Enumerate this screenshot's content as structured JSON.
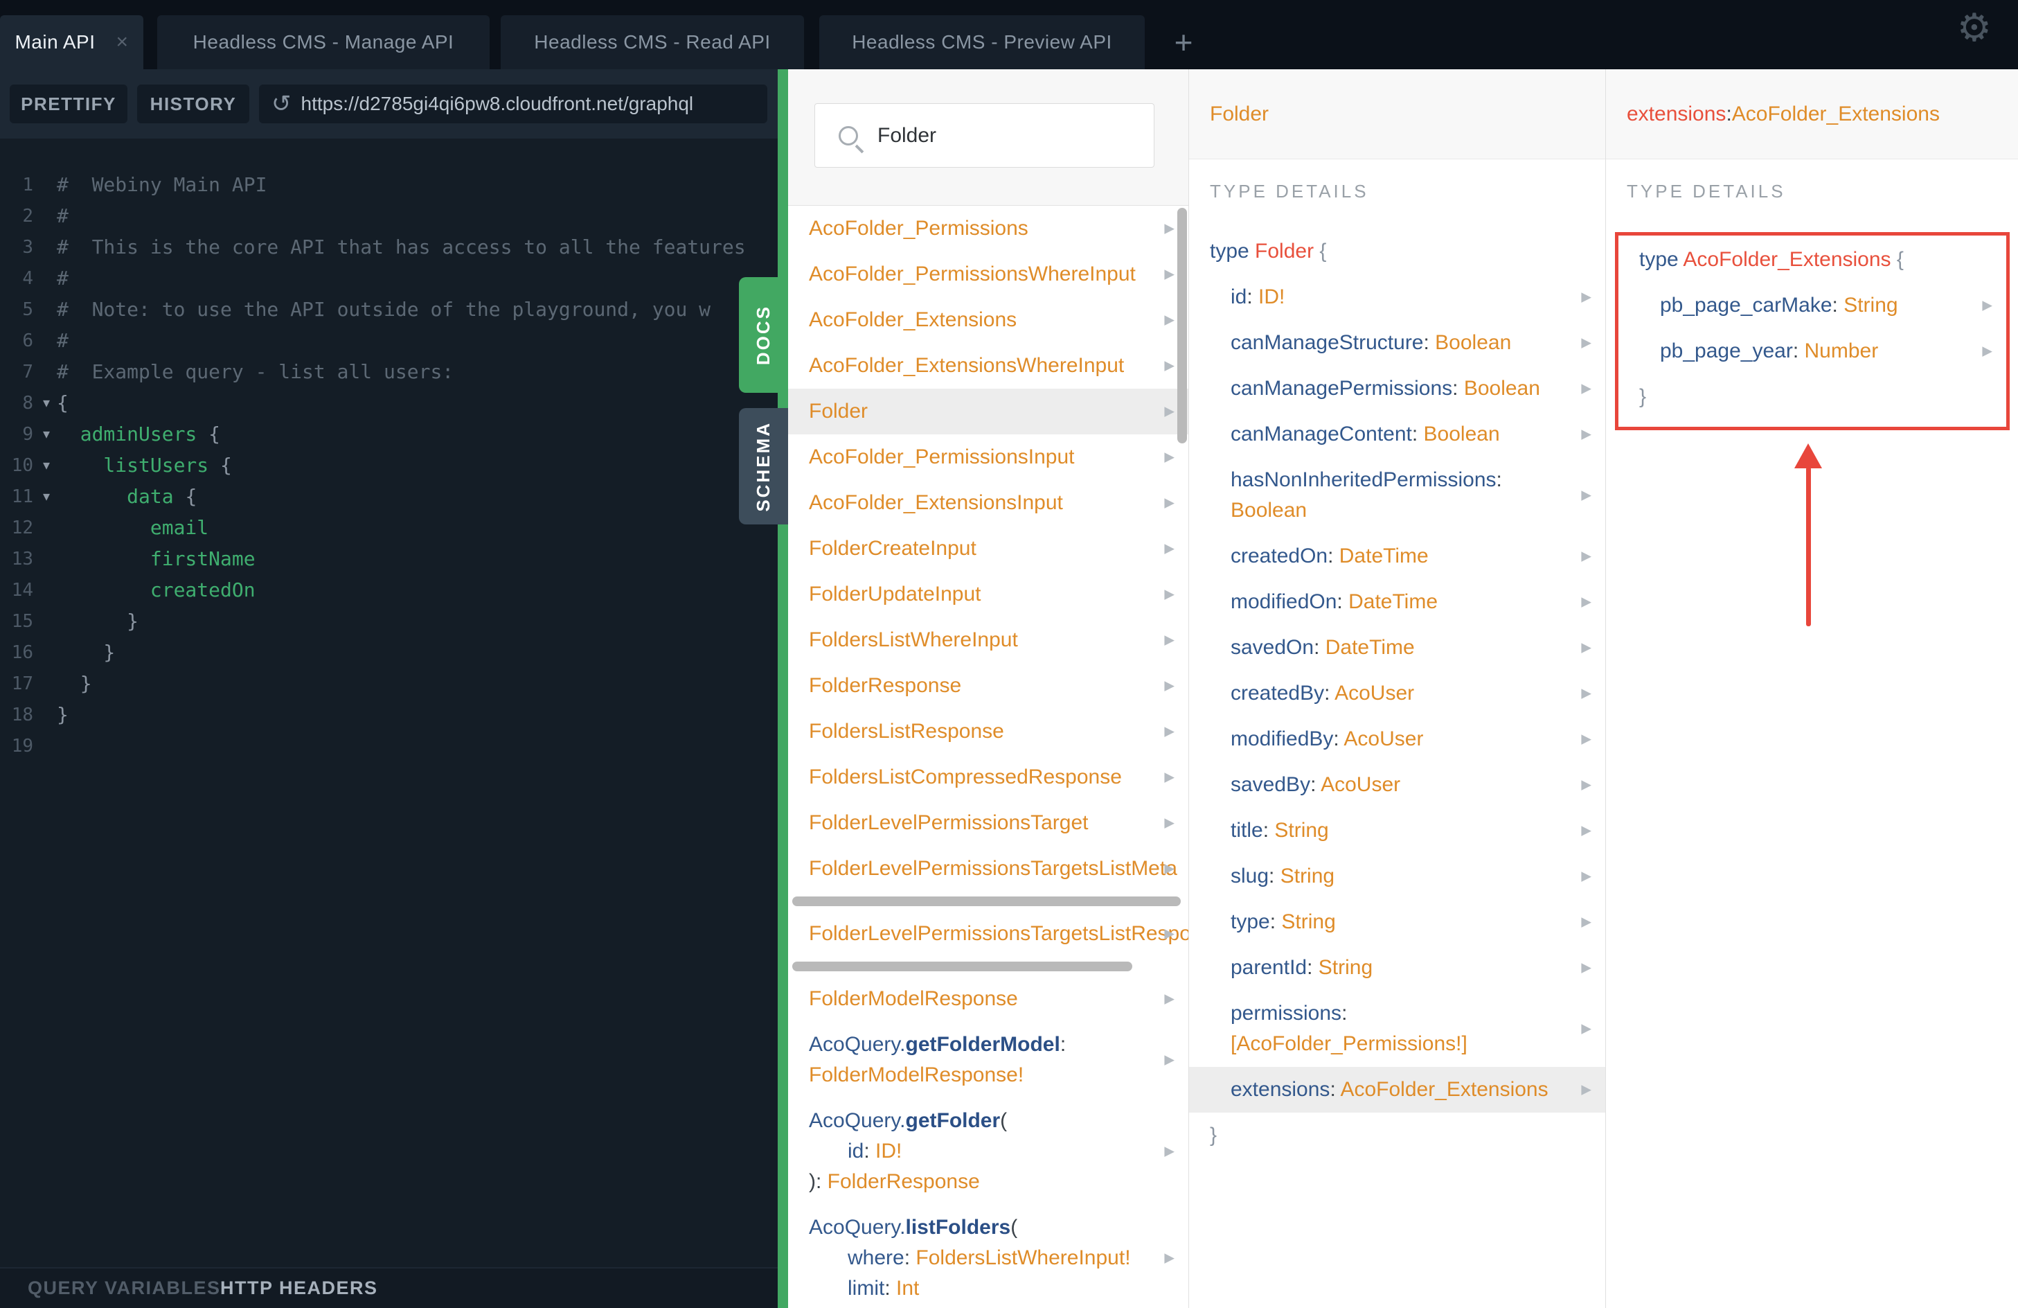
{
  "topbar": {
    "tabs": [
      {
        "label": "Main API",
        "active": true
      },
      {
        "label": "Headless CMS - Manage API",
        "active": false
      },
      {
        "label": "Headless CMS - Read API",
        "active": false
      },
      {
        "label": "Headless CMS - Preview API",
        "active": false
      }
    ],
    "close_label": "×",
    "add_label": "+",
    "gear_icon": "⚙"
  },
  "toolbar": {
    "prettify_label": "PRETTIFY",
    "history_label": "HISTORY",
    "reload_icon": "↺",
    "url": "https://d2785gi4qi6pw8.cloudfront.net/graphql"
  },
  "side_tabs": {
    "docs": "DOCS",
    "schema": "SCHEMA"
  },
  "editor": {
    "lines": [
      {
        "n": "1",
        "fold": false,
        "segments": [
          [
            "comment",
            "#  Webiny Main API"
          ]
        ]
      },
      {
        "n": "2",
        "fold": false,
        "segments": [
          [
            "comment",
            "#"
          ]
        ]
      },
      {
        "n": "3",
        "fold": false,
        "segments": [
          [
            "comment",
            "#  This is the core API that has access to all the features"
          ]
        ]
      },
      {
        "n": "4",
        "fold": false,
        "segments": [
          [
            "comment",
            "#"
          ]
        ]
      },
      {
        "n": "5",
        "fold": false,
        "segments": [
          [
            "comment",
            "#  Note: to use the API outside of the playground, you w"
          ]
        ]
      },
      {
        "n": "6",
        "fold": false,
        "segments": [
          [
            "comment",
            "#"
          ]
        ]
      },
      {
        "n": "7",
        "fold": false,
        "segments": [
          [
            "comment",
            "#  Example query - list all users:"
          ]
        ]
      },
      {
        "n": "8",
        "fold": true,
        "segments": [
          [
            "brace",
            "{"
          ]
        ]
      },
      {
        "n": "9",
        "fold": true,
        "segments": [
          [
            "green",
            "  adminUsers "
          ],
          [
            "brace",
            "{"
          ]
        ]
      },
      {
        "n": "10",
        "fold": true,
        "segments": [
          [
            "green",
            "    listUsers "
          ],
          [
            "brace",
            "{"
          ]
        ]
      },
      {
        "n": "11",
        "fold": true,
        "segments": [
          [
            "green",
            "      data "
          ],
          [
            "brace",
            "{"
          ]
        ]
      },
      {
        "n": "12",
        "fold": false,
        "segments": [
          [
            "green",
            "        email"
          ]
        ]
      },
      {
        "n": "13",
        "fold": false,
        "segments": [
          [
            "green",
            "        firstName"
          ]
        ]
      },
      {
        "n": "14",
        "fold": false,
        "segments": [
          [
            "green",
            "        createdOn"
          ]
        ]
      },
      {
        "n": "15",
        "fold": false,
        "segments": [
          [
            "brace",
            "      }"
          ]
        ]
      },
      {
        "n": "16",
        "fold": false,
        "segments": [
          [
            "brace",
            "    }"
          ]
        ]
      },
      {
        "n": "17",
        "fold": false,
        "segments": [
          [
            "brace",
            "  }"
          ]
        ]
      },
      {
        "n": "18",
        "fold": false,
        "segments": [
          [
            "brace",
            "}"
          ]
        ]
      },
      {
        "n": "19",
        "fold": false,
        "segments": []
      }
    ]
  },
  "docs": {
    "search_value": "Folder",
    "items": [
      {
        "kind": "simple",
        "text": "AcoFolder_Permissions",
        "arrow": true
      },
      {
        "kind": "simple",
        "text": "AcoFolder_PermissionsWhereInput",
        "arrow": true
      },
      {
        "kind": "simple",
        "text": "AcoFolder_Extensions",
        "arrow": true
      },
      {
        "kind": "simple",
        "text": "AcoFolder_ExtensionsWhereInput",
        "arrow": true
      },
      {
        "kind": "simple",
        "text": "Folder",
        "arrow": true,
        "highlight": true
      },
      {
        "kind": "simple",
        "text": "AcoFolder_PermissionsInput",
        "arrow": true
      },
      {
        "kind": "simple",
        "text": "AcoFolder_ExtensionsInput",
        "arrow": true
      },
      {
        "kind": "simple",
        "text": "FolderCreateInput",
        "arrow": true
      },
      {
        "kind": "simple",
        "text": "FolderUpdateInput",
        "arrow": true
      },
      {
        "kind": "simple",
        "text": "FoldersListWhereInput",
        "arrow": true
      },
      {
        "kind": "simple",
        "text": "FolderResponse",
        "arrow": true
      },
      {
        "kind": "simple",
        "text": "FoldersListResponse",
        "arrow": true
      },
      {
        "kind": "simple",
        "text": "FoldersListCompressedResponse",
        "arrow": true
      },
      {
        "kind": "simple",
        "text": "FolderLevelPermissionsTarget",
        "arrow": true
      },
      {
        "kind": "simple",
        "text": "FolderLevelPermissionsTargetsListMeta",
        "arrow": true,
        "clip": true
      },
      {
        "kind": "hscroll",
        "width_pct": 97
      },
      {
        "kind": "simple",
        "text": "FolderLevelPermissionsTargetsListResponse",
        "arrow": true,
        "clip": true
      },
      {
        "kind": "hscroll",
        "width_pct": 85
      },
      {
        "kind": "simple",
        "text": "FolderModelResponse",
        "arrow": true
      },
      {
        "kind": "block",
        "arrow": true,
        "lines": [
          {
            "indent": 0,
            "seg": [
              [
                "blue",
                "AcoQuery."
              ],
              [
                "blueb",
                "getFolderModel"
              ],
              [
                "dark",
                ":"
              ]
            ]
          },
          {
            "indent": 0,
            "seg": [
              [
                "orange",
                "FolderModelResponse!"
              ]
            ]
          }
        ]
      },
      {
        "kind": "block",
        "arrow": true,
        "lines": [
          {
            "indent": 0,
            "seg": [
              [
                "blue",
                "AcoQuery."
              ],
              [
                "blueb",
                "getFolder"
              ],
              [
                "dark",
                "("
              ]
            ]
          },
          {
            "indent": 1,
            "seg": [
              [
                "blue",
                "id"
              ],
              [
                "dark",
                ": "
              ],
              [
                "orange",
                "ID!"
              ]
            ]
          },
          {
            "indent": 0,
            "seg": [
              [
                "dark",
                "): "
              ],
              [
                "orange",
                "FolderResponse"
              ]
            ]
          }
        ]
      },
      {
        "kind": "block",
        "arrow": true,
        "lines": [
          {
            "indent": 0,
            "seg": [
              [
                "blue",
                "AcoQuery."
              ],
              [
                "blueb",
                "listFolders"
              ],
              [
                "dark",
                "("
              ]
            ]
          },
          {
            "indent": 1,
            "seg": [
              [
                "blue",
                "where"
              ],
              [
                "dark",
                ": "
              ],
              [
                "orange",
                "FoldersListWhereInput!"
              ]
            ]
          },
          {
            "indent": 1,
            "seg": [
              [
                "blue",
                "limit"
              ],
              [
                "dark",
                ": "
              ],
              [
                "orange",
                "Int"
              ]
            ]
          }
        ]
      }
    ]
  },
  "folder_pane": {
    "title": "Folder",
    "section_label": "TYPE DETAILS",
    "rows": [
      {
        "arrow": false,
        "lines": [
          {
            "indent": 0,
            "seg": [
              [
                "blue",
                "type "
              ],
              [
                "red",
                "Folder "
              ],
              [
                "gray",
                "{"
              ]
            ]
          }
        ]
      },
      {
        "arrow": true,
        "lines": [
          {
            "indent": 1,
            "seg": [
              [
                "blue",
                "id"
              ],
              [
                "dark",
                ": "
              ],
              [
                "orange",
                "ID!"
              ]
            ]
          }
        ]
      },
      {
        "arrow": true,
        "lines": [
          {
            "indent": 1,
            "seg": [
              [
                "blue",
                "canManageStructure"
              ],
              [
                "dark",
                ": "
              ],
              [
                "orange",
                "Boolean"
              ]
            ]
          }
        ]
      },
      {
        "arrow": true,
        "lines": [
          {
            "indent": 1,
            "seg": [
              [
                "blue",
                "canManagePermissions"
              ],
              [
                "dark",
                ": "
              ],
              [
                "orange",
                "Boolean"
              ]
            ]
          }
        ]
      },
      {
        "arrow": true,
        "lines": [
          {
            "indent": 1,
            "seg": [
              [
                "blue",
                "canManageContent"
              ],
              [
                "dark",
                ": "
              ],
              [
                "orange",
                "Boolean"
              ]
            ]
          }
        ]
      },
      {
        "arrow": true,
        "lines": [
          {
            "indent": 1,
            "seg": [
              [
                "blue",
                "hasNonInheritedPermissions"
              ],
              [
                "dark",
                ":"
              ]
            ]
          },
          {
            "indent": 1,
            "seg": [
              [
                "orange",
                "Boolean"
              ]
            ]
          }
        ]
      },
      {
        "arrow": true,
        "lines": [
          {
            "indent": 1,
            "seg": [
              [
                "blue",
                "createdOn"
              ],
              [
                "dark",
                ": "
              ],
              [
                "orange",
                "DateTime"
              ]
            ]
          }
        ]
      },
      {
        "arrow": true,
        "lines": [
          {
            "indent": 1,
            "seg": [
              [
                "blue",
                "modifiedOn"
              ],
              [
                "dark",
                ": "
              ],
              [
                "orange",
                "DateTime"
              ]
            ]
          }
        ]
      },
      {
        "arrow": true,
        "lines": [
          {
            "indent": 1,
            "seg": [
              [
                "blue",
                "savedOn"
              ],
              [
                "dark",
                ": "
              ],
              [
                "orange",
                "DateTime"
              ]
            ]
          }
        ]
      },
      {
        "arrow": true,
        "lines": [
          {
            "indent": 1,
            "seg": [
              [
                "blue",
                "createdBy"
              ],
              [
                "dark",
                ": "
              ],
              [
                "orange",
                "AcoUser"
              ]
            ]
          }
        ]
      },
      {
        "arrow": true,
        "lines": [
          {
            "indent": 1,
            "seg": [
              [
                "blue",
                "modifiedBy"
              ],
              [
                "dark",
                ": "
              ],
              [
                "orange",
                "AcoUser"
              ]
            ]
          }
        ]
      },
      {
        "arrow": true,
        "lines": [
          {
            "indent": 1,
            "seg": [
              [
                "blue",
                "savedBy"
              ],
              [
                "dark",
                ": "
              ],
              [
                "orange",
                "AcoUser"
              ]
            ]
          }
        ]
      },
      {
        "arrow": true,
        "lines": [
          {
            "indent": 1,
            "seg": [
              [
                "blue",
                "title"
              ],
              [
                "dark",
                ": "
              ],
              [
                "orange",
                "String"
              ]
            ]
          }
        ]
      },
      {
        "arrow": true,
        "lines": [
          {
            "indent": 1,
            "seg": [
              [
                "blue",
                "slug"
              ],
              [
                "dark",
                ": "
              ],
              [
                "orange",
                "String"
              ]
            ]
          }
        ]
      },
      {
        "arrow": true,
        "lines": [
          {
            "indent": 1,
            "seg": [
              [
                "blue",
                "type"
              ],
              [
                "dark",
                ": "
              ],
              [
                "orange",
                "String"
              ]
            ]
          }
        ]
      },
      {
        "arrow": true,
        "lines": [
          {
            "indent": 1,
            "seg": [
              [
                "blue",
                "parentId"
              ],
              [
                "dark",
                ": "
              ],
              [
                "orange",
                "String"
              ]
            ]
          }
        ]
      },
      {
        "arrow": true,
        "lines": [
          {
            "indent": 1,
            "seg": [
              [
                "blue",
                "permissions"
              ],
              [
                "dark",
                ":"
              ]
            ]
          },
          {
            "indent": 1,
            "seg": [
              [
                "orange",
                "[AcoFolder_Permissions!]"
              ]
            ]
          }
        ]
      },
      {
        "arrow": true,
        "highlight": true,
        "lines": [
          {
            "indent": 1,
            "seg": [
              [
                "blue",
                "extensions"
              ],
              [
                "dark",
                ": "
              ],
              [
                "orange",
                "AcoFolder_Extensions"
              ]
            ]
          }
        ]
      },
      {
        "arrow": false,
        "lines": [
          {
            "indent": 0,
            "seg": [
              [
                "gray",
                "}"
              ]
            ]
          }
        ]
      }
    ]
  },
  "ext_pane": {
    "title_field": "extensions",
    "title_sep": ": ",
    "title_type": "AcoFolder_Extensions",
    "section_label": "TYPE DETAILS",
    "highlight_box_color": "#e8463b",
    "rows": [
      {
        "arrow": false,
        "lines": [
          {
            "indent": 0,
            "seg": [
              [
                "blue",
                "type "
              ],
              [
                "red",
                "AcoFolder_Extensions "
              ],
              [
                "gray",
                "{"
              ]
            ]
          }
        ]
      },
      {
        "arrow": true,
        "lines": [
          {
            "indent": 1,
            "seg": [
              [
                "blue",
                "pb_page_carMake"
              ],
              [
                "dark",
                ": "
              ],
              [
                "orange",
                "String"
              ]
            ]
          }
        ]
      },
      {
        "arrow": true,
        "lines": [
          {
            "indent": 1,
            "seg": [
              [
                "blue",
                "pb_page_year"
              ],
              [
                "dark",
                ": "
              ],
              [
                "orange",
                "Number"
              ]
            ]
          }
        ]
      },
      {
        "arrow": false,
        "lines": [
          {
            "indent": 0,
            "seg": [
              [
                "gray",
                "}"
              ]
            ]
          }
        ]
      }
    ]
  },
  "bottom_bar": {
    "query_variables_label": "QUERY VARIABLES",
    "http_headers_label": "HTTP HEADERS"
  }
}
